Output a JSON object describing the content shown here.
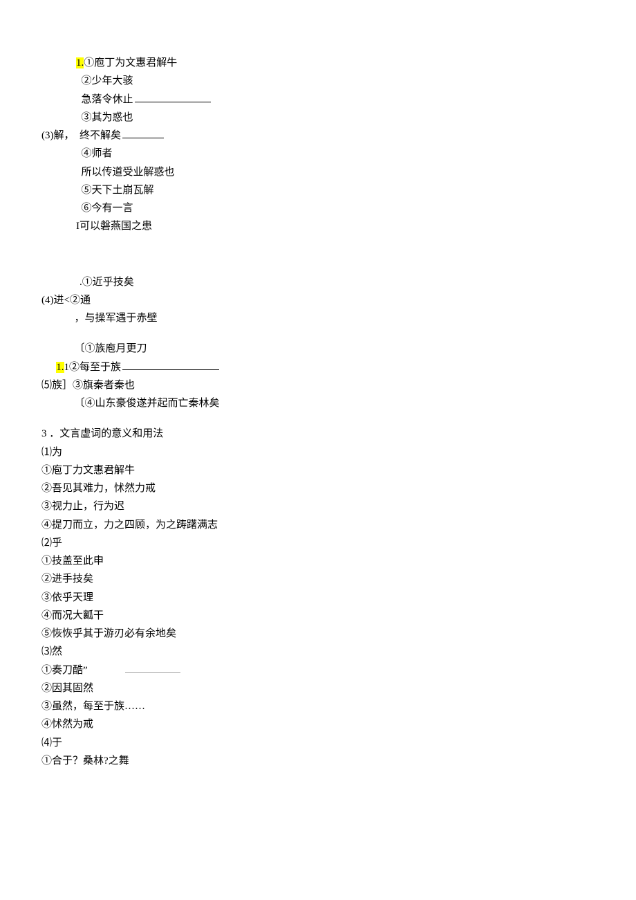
{
  "block3": {
    "label": "(3)解，",
    "lines": [
      "①庖丁为文惠君解牛",
      "②少年大骇",
      "急落令休止",
      "③其为惑也",
      "终不解矣",
      "④师者",
      "所以传道受业解惑也",
      "⑤天下土崩瓦解",
      "⑥今有一言",
      "I可以磐燕国之患"
    ],
    "hl": "1."
  },
  "block4": {
    "label": "(4)进<②通",
    "lines": [
      ".①近乎技矣",
      "，与操军遇于赤壁"
    ]
  },
  "block5": {
    "label": "⑸族］",
    "hl": "1.",
    "lines": [
      "〔①族庖月更刀",
      "1②每至于族",
      "③旗秦者秦也",
      "〔④山东豪俊遂并起而亡秦林矣"
    ]
  },
  "section3": {
    "heading": "3 ．文言虚词的意义和用法",
    "groups": [
      {
        "label": "⑴为",
        "items": [
          "①庖丁力文惠君解牛",
          "②吾见其难力，怵然力戒",
          "③视力止，行为迟",
          "④提刀而立，力之四顾，为之踌躇满志"
        ]
      },
      {
        "label": "⑵乎",
        "items": [
          "①技盖至此申",
          "②进手技矣",
          "③依乎天理",
          "④而况大瓤干",
          "⑤恢恢乎其于游刃必有余地矣"
        ]
      },
      {
        "label": "⑶然",
        "items": [
          "①奏刀酷”",
          "②因其固然",
          "③虽然，每至于族……",
          "④怵然为戒"
        ]
      },
      {
        "label": "⑷于",
        "items": [
          "①合于？桑林?之舞"
        ]
      }
    ]
  }
}
